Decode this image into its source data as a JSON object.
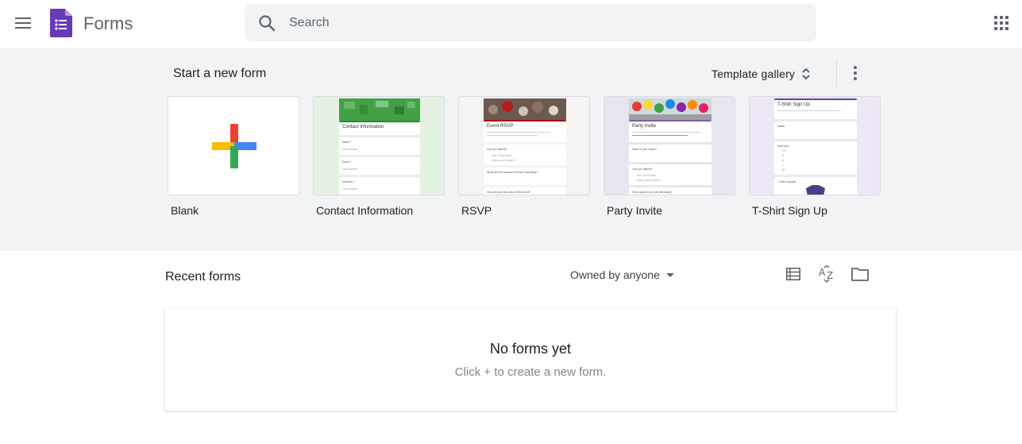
{
  "header": {
    "app_title": "Forms",
    "search_placeholder": "Search"
  },
  "templates": {
    "section_title": "Start a new form",
    "gallery_label": "Template gallery",
    "items": [
      {
        "label": "Blank"
      },
      {
        "label": "Contact Information",
        "mini_title": "Contact Information",
        "fields": [
          "Name *",
          "Email *",
          "Address *"
        ],
        "answer": "Your answer",
        "accent": "#1e8e3e"
      },
      {
        "label": "RSVP",
        "mini_title": "Event RSVP",
        "fields": [
          "Can you attend?",
          "What are the names of people attending?",
          "How did you hear about this event?"
        ],
        "options": [
          "Yes, I'll be there",
          "Sorry, can't make it"
        ],
        "accent": "#a50e0e"
      },
      {
        "label": "Party Invite",
        "mini_title": "Party Invite",
        "fields": [
          "What is your name?",
          "Can you attend?",
          "How many of you are attending?"
        ],
        "options": [
          "Yes, I'll be there",
          "Sorry, can't make it"
        ],
        "accent": "#7b61a3"
      },
      {
        "label": "T-Shirt Sign Up",
        "mini_title": "T-Shirt Sign Up",
        "fields": [
          "Name",
          "Shirt size",
          "T-Shirt Sample"
        ],
        "options": [
          "XS",
          "S",
          "M",
          "L",
          "XL"
        ],
        "accent": "#673ab7"
      }
    ]
  },
  "recent": {
    "title": "Recent forms",
    "owner_filter": "Owned by anyone",
    "empty_title": "No forms yet",
    "empty_subtitle": "Click + to create a new form."
  },
  "colors": {
    "forms_purple": "#673ab7",
    "section_bg": "#f1f3f4",
    "plus_red": "#ea4335",
    "plus_blue": "#4285f4",
    "plus_yellow": "#fbbc04",
    "plus_green": "#34a853"
  }
}
